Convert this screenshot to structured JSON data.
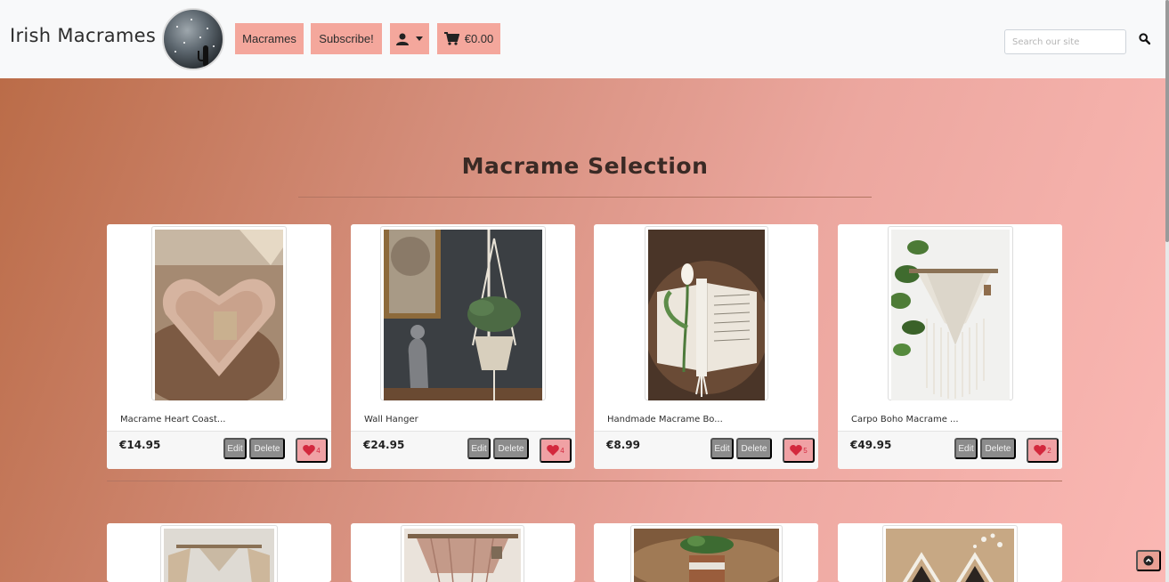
{
  "header": {
    "brand": "Irish Macrames",
    "nav": {
      "macrames_label": "Macrames",
      "subscribe_label": "Subscribe!",
      "cart_total": "€0.00"
    },
    "search": {
      "placeholder": "Search our site"
    }
  },
  "main": {
    "title": "Macrame Selection",
    "products": [
      {
        "name": "Macrame Heart Coast...",
        "price": "€14.95",
        "likes": "4",
        "edit_label": "Edit",
        "delete_label": "Delete"
      },
      {
        "name": "Wall Hanger",
        "price": "€24.95",
        "likes": "4",
        "edit_label": "Edit",
        "delete_label": "Delete"
      },
      {
        "name": "Handmade Macrame Bo...",
        "price": "€8.99",
        "likes": "5",
        "edit_label": "Edit",
        "delete_label": "Delete"
      },
      {
        "name": "Carpo Boho Macrame ...",
        "price": "€49.95",
        "likes": "2",
        "edit_label": "Edit",
        "delete_label": "Delete"
      }
    ]
  },
  "icons": {
    "account": "user-icon",
    "cart": "shopping-cart-icon",
    "search": "search-icon",
    "like": "heart-icon",
    "back_to_top": "chevron-up-circle-icon"
  },
  "colors": {
    "nav_button": "#f4a79c",
    "like_button": "#f0a1a4",
    "heart": "#d3283d",
    "admin_button": "#8c8c8c"
  }
}
